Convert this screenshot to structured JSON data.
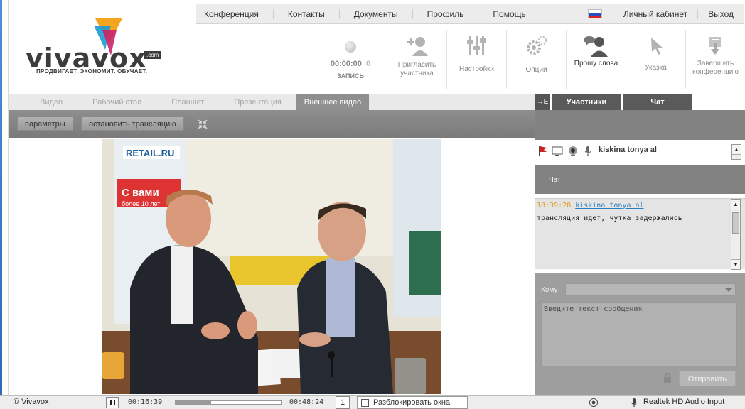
{
  "nav": {
    "items": [
      "Конференция",
      "Контакты",
      "Документы",
      "Профиль",
      "Помощь"
    ],
    "cabinet": "Личный кабинет",
    "logout": "Выход"
  },
  "logo": {
    "word": "vivavox",
    "domain": ".com",
    "tagline": "ПРОДВИГАЕТ. ЭКОНОМИТ. ОБУЧАЕТ."
  },
  "record": {
    "time": "00:00:00",
    "count": "0",
    "label": "ЗАПИСЬ"
  },
  "tools": [
    {
      "label": "Пригласить участника",
      "icon": "invite-user-icon"
    },
    {
      "label": "Настройки",
      "icon": "settings-sliders-icon"
    },
    {
      "label": "Опции",
      "icon": "gears-icon"
    },
    {
      "label": "Прошу слова",
      "icon": "request-speak-icon"
    },
    {
      "label": "Указка",
      "icon": "pointer-icon"
    },
    {
      "label": "Завершить конференцию",
      "icon": "end-conference-icon"
    }
  ],
  "tabs": [
    "Видео",
    "Рабочий стол",
    "Планшет",
    "Презентация",
    "Внешнее видео"
  ],
  "active_tab": "Внешнее видео",
  "controls": {
    "params": "параметры",
    "stop": "остановить трансляцию"
  },
  "panel": {
    "collapse_glyph": "→E",
    "tabs": [
      "Участники",
      "Чат"
    ],
    "participant": "kiskina tonya al",
    "chat_title": "Чат",
    "message": {
      "time": "18:39:28",
      "user": "kiskina tonya al",
      "text": "трансляция идет, чутка задержались"
    },
    "to_label": "Кому",
    "placeholder": "Введите текст сообщения",
    "send": "Отправить"
  },
  "status": {
    "app": "© Vivavox",
    "elapsed": "00:16:39",
    "total": "00:48:24",
    "progress": 0.34,
    "page": "1",
    "unlock": "Разблокировать окна",
    "audio": "Realtek HD Audio Input"
  },
  "colors": {
    "brand_dark": "#3c3c3c",
    "timestamp": "#e0a020",
    "user_link": "#2a7fc0"
  }
}
